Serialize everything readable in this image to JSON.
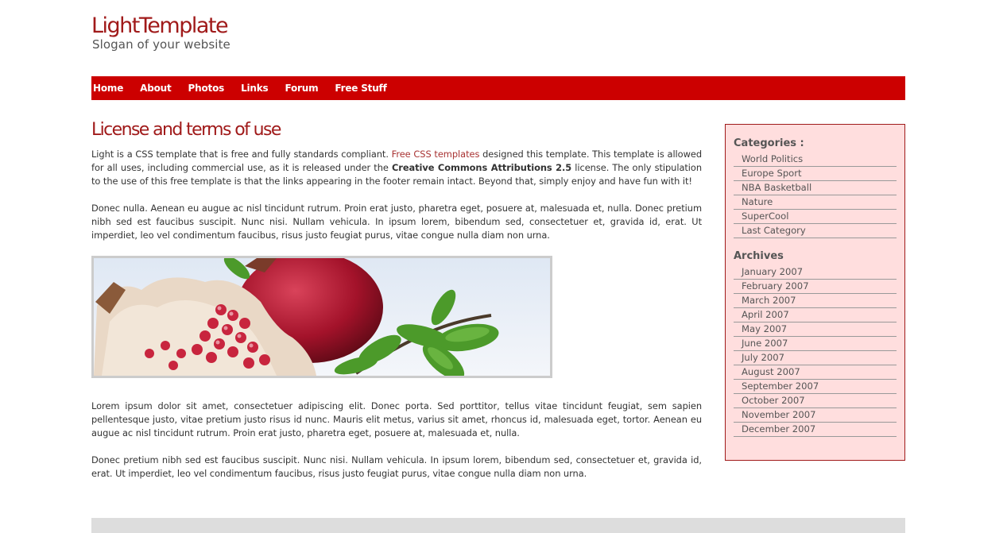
{
  "header": {
    "logo": "LightTemplate",
    "slogan": "Slogan of your website"
  },
  "nav": {
    "items": [
      "Home",
      "About",
      "Photos",
      "Links",
      "Forum",
      "Free Stuff"
    ]
  },
  "main": {
    "title": "License and terms of use",
    "p1_a": "Light is a CSS template that is free and fully standards compliant. ",
    "p1_link": "Free CSS templates",
    "p1_b": " designed this template. This template is allowed for all uses, including commercial use, as it is released under the ",
    "p1_strong": "Creative Commons Attributions 2.5",
    "p1_c": " license. The only stipulation to the use of this free template is that the links appearing in the footer remain intact. Beyond that, simply enjoy and have fun with it!",
    "p2": "Donec nulla. Aenean eu augue ac nisl tincidunt rutrum. Proin erat justo, pharetra eget, posuere at, malesuada et, nulla. Donec pretium nibh sed est faucibus suscipit. Nunc nisi. Nullam vehicula. In ipsum lorem, bibendum sed, consectetuer et, gravida id, erat. Ut imperdiet, leo vel condimentum faucibus, risus justo feugiat purus, vitae congue nulla diam non urna.",
    "p3": "Lorem ipsum dolor sit amet, consectetuer adipiscing elit. Donec porta. Sed porttitor, tellus vitae tincidunt feugiat, sem sapien pellentesque justo, vitae pretium justo risus id nunc. Mauris elit metus, varius sit amet, rhoncus id, malesuada eget, tortor. Aenean eu augue ac nisl tincidunt rutrum. Proin erat justo, pharetra eget, posuere at, malesuada et, nulla.",
    "p4": "Donec pretium nibh sed est faucibus suscipit. Nunc nisi. Nullam vehicula. In ipsum lorem, bibendum sed, consectetuer et, gravida id, erat. Ut imperdiet, leo vel condimentum faucibus, risus justo feugiat purus, vitae congue nulla diam non urna."
  },
  "sidebar": {
    "categories_title": "Categories :",
    "categories": [
      "World Politics",
      "Europe Sport",
      "NBA Basketball",
      "Nature",
      "SuperCool",
      "Last Category"
    ],
    "archives_title": "Archives",
    "archives": [
      "January 2007",
      "February 2007",
      "March 2007",
      "April 2007",
      "May 2007",
      "June 2007",
      "July 2007",
      "August 2007",
      "September 2007",
      "October 2007",
      "November 2007",
      "December 2007"
    ]
  },
  "colors": {
    "accent": "#cc0000",
    "title": "#a01a1a",
    "sidebar_bg": "#ffdede"
  }
}
